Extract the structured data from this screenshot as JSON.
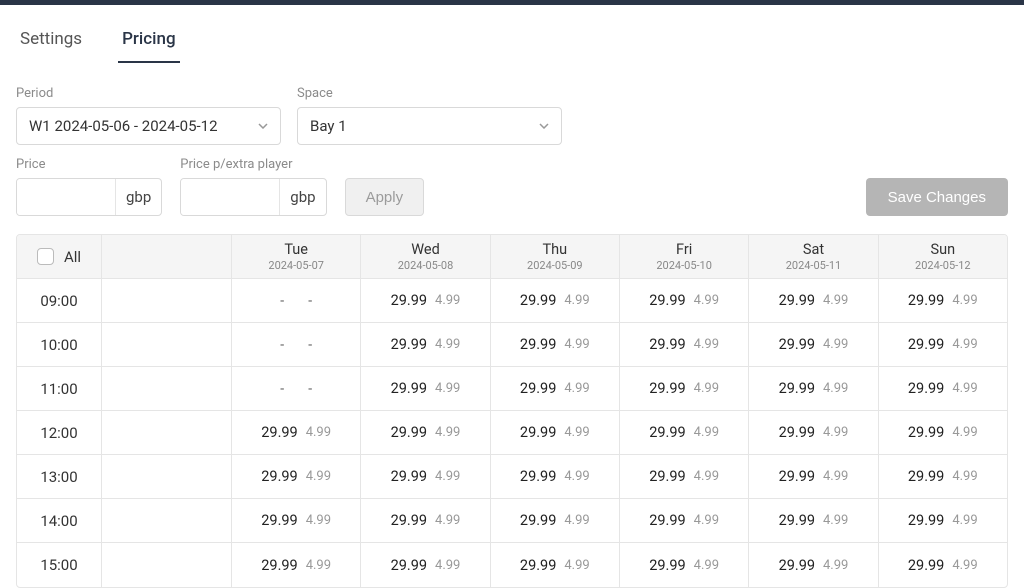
{
  "tabs": {
    "settings": "Settings",
    "pricing": "Pricing"
  },
  "filters": {
    "period_label": "Period",
    "period_value": "W1 2024-05-06 - 2024-05-12",
    "space_label": "Space",
    "space_value": "Bay 1",
    "price_label": "Price",
    "price_value": "",
    "price_suffix": "gbp",
    "price_extra_label": "Price p/extra player",
    "price_extra_value": "",
    "price_extra_suffix": "gbp",
    "apply_label": "Apply",
    "save_label": "Save Changes"
  },
  "table": {
    "all_label": "All",
    "days": [
      {
        "name": "Tue",
        "date": "2024-05-07"
      },
      {
        "name": "Wed",
        "date": "2024-05-08"
      },
      {
        "name": "Thu",
        "date": "2024-05-09"
      },
      {
        "name": "Fri",
        "date": "2024-05-10"
      },
      {
        "name": "Sat",
        "date": "2024-05-11"
      },
      {
        "name": "Sun",
        "date": "2024-05-12"
      }
    ],
    "rows": [
      {
        "time": "09:00",
        "cells": [
          {
            "p": "-",
            "e": "-"
          },
          {
            "p": "29.99",
            "e": "4.99"
          },
          {
            "p": "29.99",
            "e": "4.99"
          },
          {
            "p": "29.99",
            "e": "4.99"
          },
          {
            "p": "29.99",
            "e": "4.99"
          },
          {
            "p": "29.99",
            "e": "4.99"
          }
        ]
      },
      {
        "time": "10:00",
        "cells": [
          {
            "p": "-",
            "e": "-"
          },
          {
            "p": "29.99",
            "e": "4.99"
          },
          {
            "p": "29.99",
            "e": "4.99"
          },
          {
            "p": "29.99",
            "e": "4.99"
          },
          {
            "p": "29.99",
            "e": "4.99"
          },
          {
            "p": "29.99",
            "e": "4.99"
          }
        ]
      },
      {
        "time": "11:00",
        "cells": [
          {
            "p": "-",
            "e": "-"
          },
          {
            "p": "29.99",
            "e": "4.99"
          },
          {
            "p": "29.99",
            "e": "4.99"
          },
          {
            "p": "29.99",
            "e": "4.99"
          },
          {
            "p": "29.99",
            "e": "4.99"
          },
          {
            "p": "29.99",
            "e": "4.99"
          }
        ]
      },
      {
        "time": "12:00",
        "cells": [
          {
            "p": "29.99",
            "e": "4.99"
          },
          {
            "p": "29.99",
            "e": "4.99"
          },
          {
            "p": "29.99",
            "e": "4.99"
          },
          {
            "p": "29.99",
            "e": "4.99"
          },
          {
            "p": "29.99",
            "e": "4.99"
          },
          {
            "p": "29.99",
            "e": "4.99"
          }
        ]
      },
      {
        "time": "13:00",
        "cells": [
          {
            "p": "29.99",
            "e": "4.99"
          },
          {
            "p": "29.99",
            "e": "4.99"
          },
          {
            "p": "29.99",
            "e": "4.99"
          },
          {
            "p": "29.99",
            "e": "4.99"
          },
          {
            "p": "29.99",
            "e": "4.99"
          },
          {
            "p": "29.99",
            "e": "4.99"
          }
        ]
      },
      {
        "time": "14:00",
        "cells": [
          {
            "p": "29.99",
            "e": "4.99"
          },
          {
            "p": "29.99",
            "e": "4.99"
          },
          {
            "p": "29.99",
            "e": "4.99"
          },
          {
            "p": "29.99",
            "e": "4.99"
          },
          {
            "p": "29.99",
            "e": "4.99"
          },
          {
            "p": "29.99",
            "e": "4.99"
          }
        ]
      },
      {
        "time": "15:00",
        "cells": [
          {
            "p": "29.99",
            "e": "4.99"
          },
          {
            "p": "29.99",
            "e": "4.99"
          },
          {
            "p": "29.99",
            "e": "4.99"
          },
          {
            "p": "29.99",
            "e": "4.99"
          },
          {
            "p": "29.99",
            "e": "4.99"
          },
          {
            "p": "29.99",
            "e": "4.99"
          }
        ]
      }
    ]
  }
}
